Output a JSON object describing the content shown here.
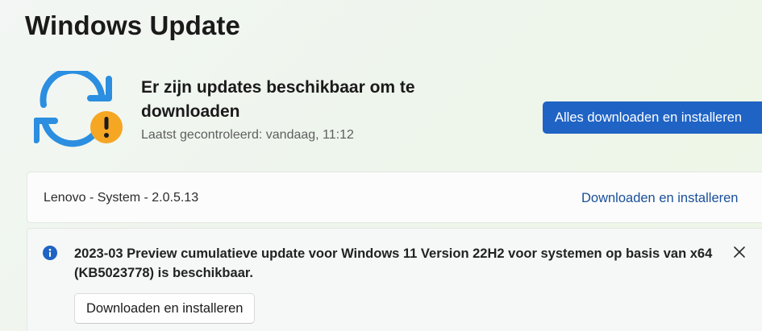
{
  "page": {
    "title": "Windows Update"
  },
  "status": {
    "icon": "sync-warning-icon",
    "heading": "Er zijn updates beschikbaar om te downloaden",
    "last_checked": "Laatst gecontroleerd: vandaag, 11:12",
    "primary_button_label": "Alles downloaden en installeren"
  },
  "updates": [
    {
      "name": "Lenovo - System - 2.0.5.13",
      "action_label": "Downloaden en installeren"
    }
  ],
  "info_bar": {
    "icon": "info-icon",
    "message": "2023-03 Preview cumulatieve update voor Windows 11 Version 22H2 voor systemen op basis van x64 (KB5023778) is beschikbaar.",
    "button_label": "Downloaden en installeren",
    "close_icon": "close-icon"
  },
  "colors": {
    "accent": "#1f63c5",
    "link": "#1a4f9c",
    "sync_icon_blue": "#2b8ee0",
    "warning_badge": "#f5a623",
    "info_icon": "#1f63c5"
  }
}
